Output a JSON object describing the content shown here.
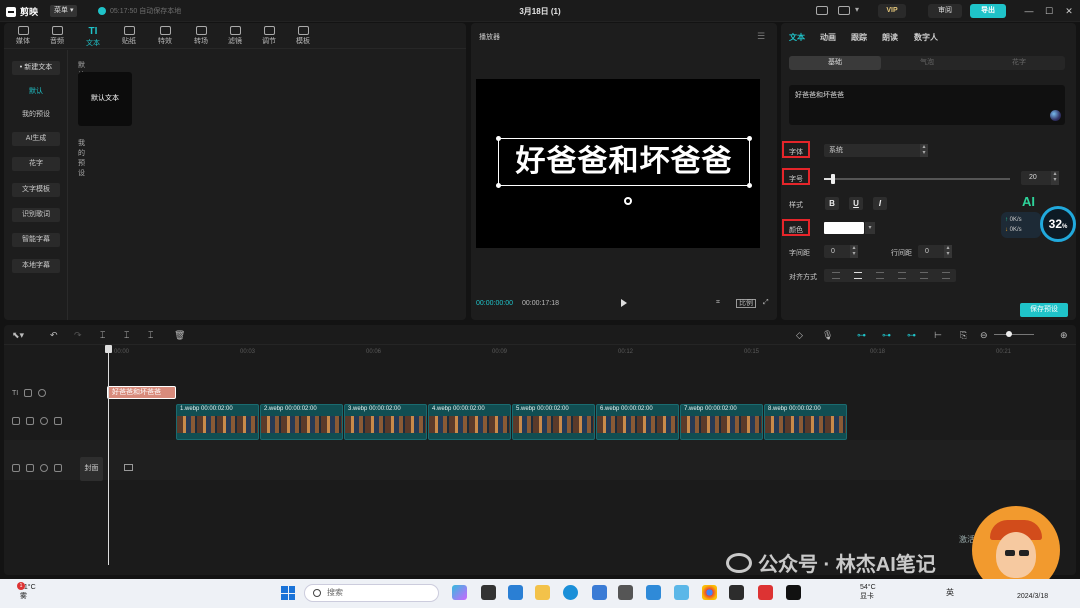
{
  "app": {
    "name": "剪映",
    "menu": "菜单",
    "autosave": "05:17:50 自动保存本地",
    "project_title": "3月18日 (1)",
    "vip": "VIP",
    "review": "审阅",
    "export": "导出"
  },
  "toolbar": [
    {
      "label": "媒体",
      "icon": "media-icon"
    },
    {
      "label": "音频",
      "icon": "audio-icon"
    },
    {
      "label": "文本",
      "icon": "text-icon",
      "glyph": "TI"
    },
    {
      "label": "贴纸",
      "icon": "sticker-icon"
    },
    {
      "label": "特效",
      "icon": "effects-icon"
    },
    {
      "label": "转场",
      "icon": "transition-icon"
    },
    {
      "label": "滤镜",
      "icon": "filter-icon"
    },
    {
      "label": "调节",
      "icon": "adjust-icon"
    },
    {
      "label": "模板",
      "icon": "template-icon"
    }
  ],
  "sidebar": [
    "• 新建文本",
    "默认",
    "我的预设",
    "AI生成",
    "花字",
    "文字模板",
    "识别歌词",
    "智能字幕",
    "本地字幕"
  ],
  "library": {
    "section_default": "默认",
    "card_label": "默认文本",
    "section_preset": "我的预设"
  },
  "player": {
    "title": "播放器",
    "caption": "好爸爸和坏爸爸",
    "timecode_current": "00:00:00:00",
    "timecode_total": "00:00:17:18",
    "ratio": "比例"
  },
  "properties": {
    "tabs": [
      "文本",
      "动画",
      "跟踪",
      "朗读",
      "数字人"
    ],
    "subtabs": [
      "基础",
      "气泡",
      "花字"
    ],
    "text_value": "好爸爸和坏爸爸",
    "font_label": "字体",
    "font_value": "系统",
    "size_label": "字号",
    "size_value": "20",
    "size_fraction": 0.05,
    "style_label": "样式",
    "style_buttons": [
      "B",
      "U",
      "I"
    ],
    "color_label": "颜色",
    "color_value": "#ffffff",
    "letter_spacing_label": "字间距",
    "letter_spacing_value": "0",
    "line_spacing_label": "行间距",
    "line_spacing_value": "0",
    "align_label": "对齐方式",
    "save_preset": "保存预设"
  },
  "net_widget": {
    "ai": "AI",
    "up": "0K/s",
    "down": "0K/s",
    "percent": "32",
    "unit": "%"
  },
  "timeline": {
    "ticks": [
      "00:00",
      "00:03",
      "00:06",
      "00:09",
      "00:12",
      "00:15",
      "00:18",
      "00:21"
    ],
    "text_clip": "好爸爸和坏爸爸",
    "video_clips": [
      {
        "name": "1.webp",
        "duration": "00:00:02:00"
      },
      {
        "name": "2.webp",
        "duration": "00:00:02:00"
      },
      {
        "name": "3.webp",
        "duration": "00:00:02:00"
      },
      {
        "name": "4.webp",
        "duration": "00:00:02:00"
      },
      {
        "name": "5.webp",
        "duration": "00:00:02:00"
      },
      {
        "name": "6.webp",
        "duration": "00:00:02:00"
      },
      {
        "name": "7.webp",
        "duration": "00:00:02:00"
      },
      {
        "name": "8.webp",
        "duration": "00:00:02:00"
      }
    ],
    "cover": "封面",
    "track_type_text": "TI"
  },
  "taskbar": {
    "temp": "21°C",
    "weather": "雾",
    "badge": "1",
    "search": "搜索",
    "tray_temp": "54°C",
    "tray_label": "显卡",
    "lang": "英",
    "date": "2024/3/18"
  },
  "watermark": {
    "activate": "激活 Windows",
    "gzh": "公众号 · 林杰AI笔记"
  }
}
